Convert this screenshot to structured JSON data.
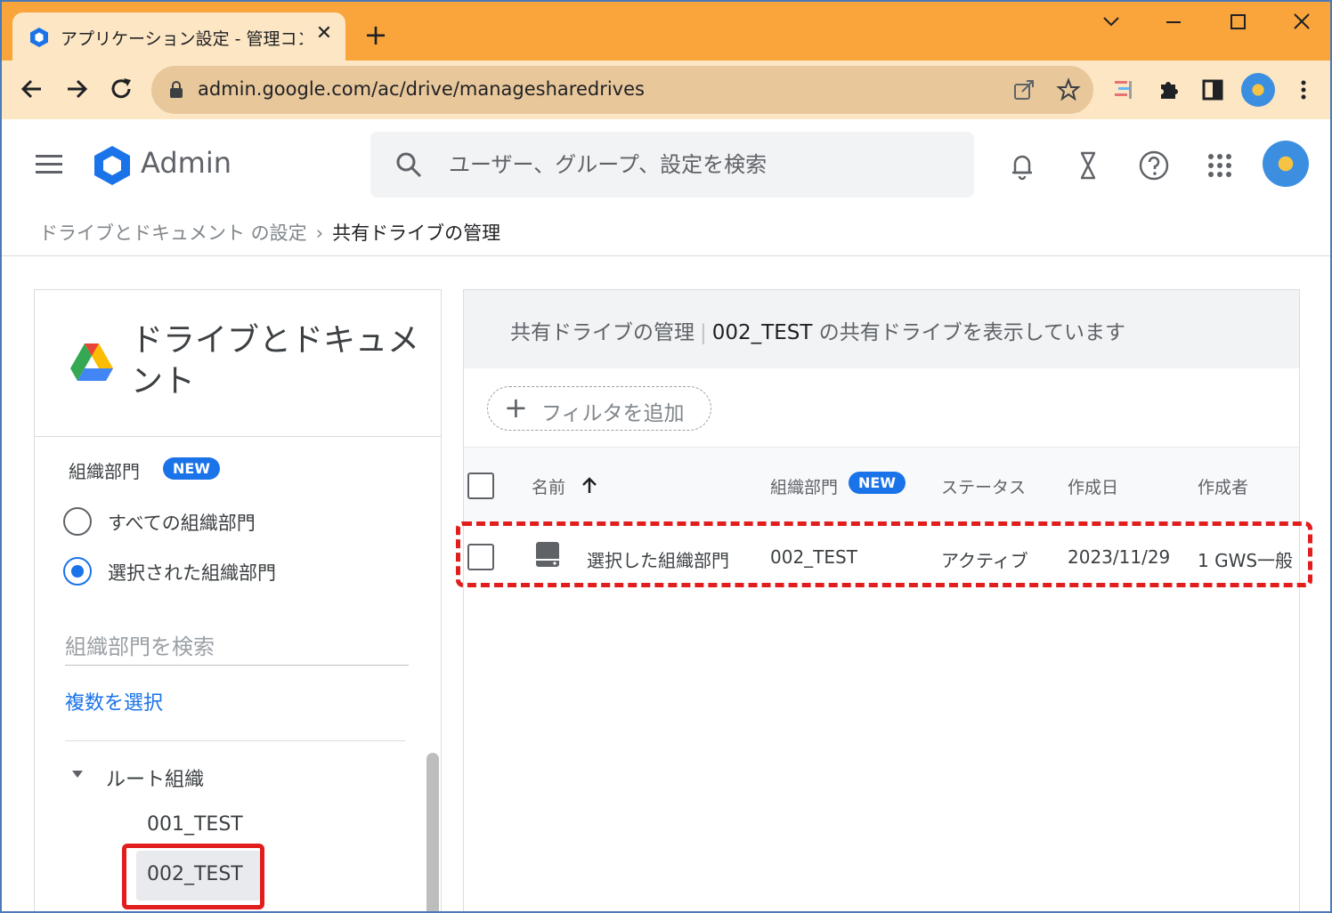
{
  "browser": {
    "tab_title": "アプリケーション設定 - 管理コンソール",
    "url": "admin.google.com/ac/drive/managesharedrives"
  },
  "header": {
    "app_title": "Admin",
    "search_placeholder": "ユーザー、グループ、設定を検索"
  },
  "breadcrumb": {
    "parent": "ドライブとドキュメント の設定",
    "separator": "›",
    "current": "共有ドライブの管理"
  },
  "sidebar": {
    "title": "ドライブとドキュメント",
    "ou_label": "組織部門",
    "new_badge": "NEW",
    "radio_all": "すべての組織部門",
    "radio_selected": "選択された組織部門",
    "ou_search_placeholder": "組織部門を検索",
    "multi_select": "複数を選択",
    "tree": {
      "root": "ルート組織",
      "children": [
        "001_TEST",
        "002_TEST"
      ]
    }
  },
  "main": {
    "heading_prefix": "共有ドライブの管理",
    "heading_sep": "|",
    "heading_ou": "002_TEST",
    "heading_suffix": " の共有ドライブを表示しています",
    "filter_label": "フィルタを追加",
    "columns": {
      "name": "名前",
      "ou": "組織部門",
      "ou_badge": "NEW",
      "status": "ステータス",
      "created": "作成日",
      "creator": "作成者"
    },
    "rows": [
      {
        "name": "選択した組織部門",
        "ou": "002_TEST",
        "status": "アクティブ",
        "created": "2023/11/29",
        "creator": "1 GWS一般"
      }
    ]
  },
  "colors": {
    "tabstrip": "#f9a53c",
    "toolbar": "#fde6c4",
    "accent": "#1a73e8",
    "highlight": "#e11d1d"
  }
}
